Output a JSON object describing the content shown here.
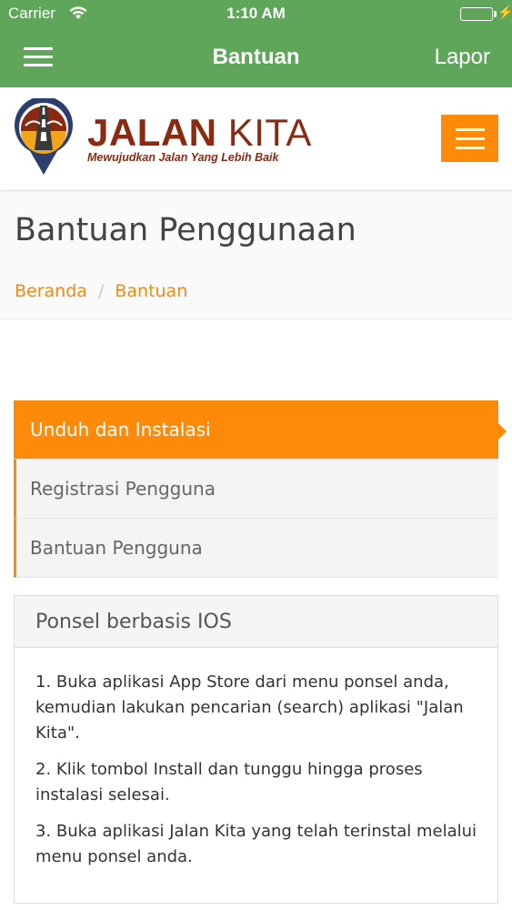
{
  "status_bar": {
    "carrier": "Carrier",
    "time": "1:10 AM"
  },
  "nav_bar": {
    "title": "Bantuan",
    "report_label": "Lapor"
  },
  "logo": {
    "name_bold": "JALAN",
    "name_light": "KITA",
    "tagline": "Mewujudkan Jalan Yang Lebih Baik"
  },
  "page": {
    "title": "Bantuan Penggunaan",
    "breadcrumb": {
      "home": "Beranda",
      "separator": "/",
      "current": "Bantuan"
    }
  },
  "tabs": [
    {
      "label": "Unduh dan Instalasi",
      "active": true
    },
    {
      "label": "Registrasi Pengguna",
      "active": false
    },
    {
      "label": "Bantuan Pengguna",
      "active": false
    }
  ],
  "panel": {
    "heading": "Ponsel berbasis IOS",
    "steps": [
      "1. Buka aplikasi App Store dari menu ponsel anda, kemudian lakukan pencarian (search) aplikasi \"Jalan Kita\".",
      "2. Klik tombol Install dan tunggu hingga proses instalasi selesai.",
      "3. Buka aplikasi Jalan Kita yang telah terinstal melalui menu ponsel anda."
    ]
  },
  "colors": {
    "nav_green": "#5fa55a",
    "accent_orange": "#ff8a0a",
    "logo_brown": "#8a2a12"
  },
  "icons": [
    "wifi-icon",
    "battery-icon",
    "charging-bolt-icon",
    "hamburger-menu-icon",
    "logo-pin-icon"
  ]
}
